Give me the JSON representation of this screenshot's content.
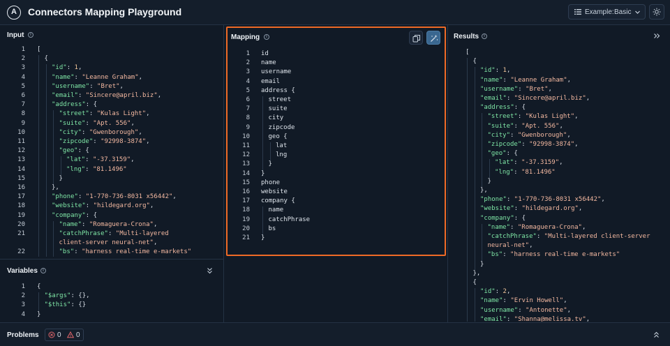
{
  "app": {
    "title": "Connectors Mapping Playground",
    "logo_letter": "A"
  },
  "header": {
    "example_label": "Example:",
    "example_value": "Basic"
  },
  "panels": {
    "input": "Input",
    "variables": "Variables",
    "mapping": "Mapping",
    "results": "Results",
    "problems": "Problems"
  },
  "problems": {
    "errors": "0",
    "warnings": "0"
  },
  "input_lines": [
    {
      "n": "1",
      "i": 0,
      "t": [
        [
          "punc",
          "["
        ]
      ]
    },
    {
      "n": "2",
      "i": 1,
      "t": [
        [
          "punc",
          "{"
        ]
      ]
    },
    {
      "n": "3",
      "i": 2,
      "t": [
        [
          "key",
          "\"id\""
        ],
        [
          "punc",
          ": "
        ],
        [
          "num",
          "1"
        ],
        [
          "punc",
          ","
        ]
      ]
    },
    {
      "n": "4",
      "i": 2,
      "t": [
        [
          "key",
          "\"name\""
        ],
        [
          "punc",
          ": "
        ],
        [
          "str",
          "\"Leanne Graham\""
        ],
        [
          "punc",
          ","
        ]
      ]
    },
    {
      "n": "5",
      "i": 2,
      "t": [
        [
          "key",
          "\"username\""
        ],
        [
          "punc",
          ": "
        ],
        [
          "str",
          "\"Bret\""
        ],
        [
          "punc",
          ","
        ]
      ]
    },
    {
      "n": "6",
      "i": 2,
      "t": [
        [
          "key",
          "\"email\""
        ],
        [
          "punc",
          ": "
        ],
        [
          "str",
          "\"Sincere@april.biz\""
        ],
        [
          "punc",
          ","
        ]
      ]
    },
    {
      "n": "7",
      "i": 2,
      "t": [
        [
          "key",
          "\"address\""
        ],
        [
          "punc",
          ": {"
        ]
      ]
    },
    {
      "n": "8",
      "i": 3,
      "t": [
        [
          "key",
          "\"street\""
        ],
        [
          "punc",
          ": "
        ],
        [
          "str",
          "\"Kulas Light\""
        ],
        [
          "punc",
          ","
        ]
      ]
    },
    {
      "n": "9",
      "i": 3,
      "t": [
        [
          "key",
          "\"suite\""
        ],
        [
          "punc",
          ": "
        ],
        [
          "str",
          "\"Apt. 556\""
        ],
        [
          "punc",
          ","
        ]
      ]
    },
    {
      "n": "10",
      "i": 3,
      "t": [
        [
          "key",
          "\"city\""
        ],
        [
          "punc",
          ": "
        ],
        [
          "str",
          "\"Gwenborough\""
        ],
        [
          "punc",
          ","
        ]
      ]
    },
    {
      "n": "11",
      "i": 3,
      "t": [
        [
          "key",
          "\"zipcode\""
        ],
        [
          "punc",
          ": "
        ],
        [
          "str",
          "\"92998-3874\""
        ],
        [
          "punc",
          ","
        ]
      ]
    },
    {
      "n": "12",
      "i": 3,
      "t": [
        [
          "key",
          "\"geo\""
        ],
        [
          "punc",
          ": {"
        ]
      ]
    },
    {
      "n": "13",
      "i": 4,
      "t": [
        [
          "key",
          "\"lat\""
        ],
        [
          "punc",
          ": "
        ],
        [
          "str",
          "\"-37.3159\""
        ],
        [
          "punc",
          ","
        ]
      ]
    },
    {
      "n": "14",
      "i": 4,
      "t": [
        [
          "key",
          "\"lng\""
        ],
        [
          "punc",
          ": "
        ],
        [
          "str",
          "\"81.1496\""
        ]
      ]
    },
    {
      "n": "15",
      "i": 3,
      "t": [
        [
          "punc",
          "}"
        ]
      ]
    },
    {
      "n": "16",
      "i": 2,
      "t": [
        [
          "punc",
          "},"
        ]
      ]
    },
    {
      "n": "17",
      "i": 2,
      "t": [
        [
          "key",
          "\"phone\""
        ],
        [
          "punc",
          ": "
        ],
        [
          "str",
          "\"1-770-736-8031 x56442\""
        ],
        [
          "punc",
          ","
        ]
      ]
    },
    {
      "n": "18",
      "i": 2,
      "t": [
        [
          "key",
          "\"website\""
        ],
        [
          "punc",
          ": "
        ],
        [
          "str",
          "\"hildegard.org\""
        ],
        [
          "punc",
          ","
        ]
      ]
    },
    {
      "n": "19",
      "i": 2,
      "t": [
        [
          "key",
          "\"company\""
        ],
        [
          "punc",
          ": {"
        ]
      ]
    },
    {
      "n": "20",
      "i": 3,
      "t": [
        [
          "key",
          "\"name\""
        ],
        [
          "punc",
          ": "
        ],
        [
          "str",
          "\"Romaguera-Crona\""
        ],
        [
          "punc",
          ","
        ]
      ]
    },
    {
      "n": "21",
      "i": 3,
      "t": [
        [
          "key",
          "\"catchPhrase\""
        ],
        [
          "punc",
          ": "
        ],
        [
          "str",
          "\"Multi-layered"
        ]
      ]
    },
    {
      "n": "",
      "i": 3,
      "t": [
        [
          "str",
          "client-server neural-net\""
        ],
        [
          "punc",
          ","
        ]
      ]
    },
    {
      "n": "22",
      "i": 3,
      "t": [
        [
          "key",
          "\"bs\""
        ],
        [
          "punc",
          ": "
        ],
        [
          "str",
          "\"harness real-time e-markets\""
        ]
      ]
    }
  ],
  "variables_lines": [
    {
      "n": "1",
      "i": 0,
      "t": [
        [
          "punc",
          "{"
        ]
      ]
    },
    {
      "n": "2",
      "i": 1,
      "t": [
        [
          "key",
          "\"$args\""
        ],
        [
          "punc",
          ": {},"
        ]
      ]
    },
    {
      "n": "3",
      "i": 1,
      "t": [
        [
          "key",
          "\"$this\""
        ],
        [
          "punc",
          ": {}"
        ]
      ]
    },
    {
      "n": "4",
      "i": 0,
      "t": [
        [
          "punc",
          "}"
        ]
      ]
    }
  ],
  "mapping_lines": [
    {
      "n": "1",
      "i": 0,
      "t": [
        [
          "ident",
          "id"
        ]
      ]
    },
    {
      "n": "2",
      "i": 0,
      "t": [
        [
          "ident",
          "name"
        ]
      ]
    },
    {
      "n": "3",
      "i": 0,
      "t": [
        [
          "ident",
          "username"
        ]
      ]
    },
    {
      "n": "4",
      "i": 0,
      "t": [
        [
          "ident",
          "email"
        ]
      ]
    },
    {
      "n": "5",
      "i": 0,
      "t": [
        [
          "ident",
          "address {"
        ]
      ]
    },
    {
      "n": "6",
      "i": 1,
      "t": [
        [
          "ident",
          "street"
        ]
      ]
    },
    {
      "n": "7",
      "i": 1,
      "t": [
        [
          "ident",
          "suite"
        ]
      ]
    },
    {
      "n": "8",
      "i": 1,
      "t": [
        [
          "ident",
          "city"
        ]
      ]
    },
    {
      "n": "9",
      "i": 1,
      "t": [
        [
          "ident",
          "zipcode"
        ]
      ]
    },
    {
      "n": "10",
      "i": 1,
      "t": [
        [
          "ident",
          "geo {"
        ]
      ]
    },
    {
      "n": "11",
      "i": 2,
      "t": [
        [
          "ident",
          "lat"
        ]
      ]
    },
    {
      "n": "12",
      "i": 2,
      "t": [
        [
          "ident",
          "lng"
        ]
      ]
    },
    {
      "n": "13",
      "i": 1,
      "t": [
        [
          "ident",
          "}"
        ]
      ]
    },
    {
      "n": "14",
      "i": 0,
      "t": [
        [
          "ident",
          "}"
        ]
      ]
    },
    {
      "n": "15",
      "i": 0,
      "t": [
        [
          "ident",
          "phone"
        ]
      ]
    },
    {
      "n": "16",
      "i": 0,
      "t": [
        [
          "ident",
          "website"
        ]
      ]
    },
    {
      "n": "17",
      "i": 0,
      "t": [
        [
          "ident",
          "company {"
        ]
      ]
    },
    {
      "n": "18",
      "i": 1,
      "t": [
        [
          "ident",
          "name"
        ]
      ]
    },
    {
      "n": "19",
      "i": 1,
      "t": [
        [
          "ident",
          "catchPhrase"
        ]
      ]
    },
    {
      "n": "20",
      "i": 1,
      "t": [
        [
          "ident",
          "bs"
        ]
      ]
    },
    {
      "n": "21",
      "i": 0,
      "t": [
        [
          "ident",
          "}"
        ]
      ]
    }
  ],
  "results_lines": [
    {
      "i": 0,
      "t": [
        [
          "punc",
          "["
        ]
      ]
    },
    {
      "i": 1,
      "t": [
        [
          "punc",
          "{"
        ]
      ]
    },
    {
      "i": 2,
      "t": [
        [
          "key",
          "\"id\""
        ],
        [
          "punc",
          ": "
        ],
        [
          "num",
          "1"
        ],
        [
          "punc",
          ","
        ]
      ]
    },
    {
      "i": 2,
      "t": [
        [
          "key",
          "\"name\""
        ],
        [
          "punc",
          ": "
        ],
        [
          "str",
          "\"Leanne Graham\""
        ],
        [
          "punc",
          ","
        ]
      ]
    },
    {
      "i": 2,
      "t": [
        [
          "key",
          "\"username\""
        ],
        [
          "punc",
          ": "
        ],
        [
          "str",
          "\"Bret\""
        ],
        [
          "punc",
          ","
        ]
      ]
    },
    {
      "i": 2,
      "t": [
        [
          "key",
          "\"email\""
        ],
        [
          "punc",
          ": "
        ],
        [
          "str",
          "\"Sincere@april.biz\""
        ],
        [
          "punc",
          ","
        ]
      ]
    },
    {
      "i": 2,
      "t": [
        [
          "key",
          "\"address\""
        ],
        [
          "punc",
          ": {"
        ]
      ]
    },
    {
      "i": 3,
      "t": [
        [
          "key",
          "\"street\""
        ],
        [
          "punc",
          ": "
        ],
        [
          "str",
          "\"Kulas Light\""
        ],
        [
          "punc",
          ","
        ]
      ]
    },
    {
      "i": 3,
      "t": [
        [
          "key",
          "\"suite\""
        ],
        [
          "punc",
          ": "
        ],
        [
          "str",
          "\"Apt. 556\""
        ],
        [
          "punc",
          ","
        ]
      ]
    },
    {
      "i": 3,
      "t": [
        [
          "key",
          "\"city\""
        ],
        [
          "punc",
          ": "
        ],
        [
          "str",
          "\"Gwenborough\""
        ],
        [
          "punc",
          ","
        ]
      ]
    },
    {
      "i": 3,
      "t": [
        [
          "key",
          "\"zipcode\""
        ],
        [
          "punc",
          ": "
        ],
        [
          "str",
          "\"92998-3874\""
        ],
        [
          "punc",
          ","
        ]
      ]
    },
    {
      "i": 3,
      "t": [
        [
          "key",
          "\"geo\""
        ],
        [
          "punc",
          ": {"
        ]
      ]
    },
    {
      "i": 4,
      "t": [
        [
          "key",
          "\"lat\""
        ],
        [
          "punc",
          ": "
        ],
        [
          "str",
          "\"-37.3159\""
        ],
        [
          "punc",
          ","
        ]
      ]
    },
    {
      "i": 4,
      "t": [
        [
          "key",
          "\"lng\""
        ],
        [
          "punc",
          ": "
        ],
        [
          "str",
          "\"81.1496\""
        ]
      ]
    },
    {
      "i": 3,
      "t": [
        [
          "punc",
          "}"
        ]
      ]
    },
    {
      "i": 2,
      "t": [
        [
          "punc",
          "},"
        ]
      ]
    },
    {
      "i": 2,
      "t": [
        [
          "key",
          "\"phone\""
        ],
        [
          "punc",
          ": "
        ],
        [
          "str",
          "\"1-770-736-8031 x56442\""
        ],
        [
          "punc",
          ","
        ]
      ]
    },
    {
      "i": 2,
      "t": [
        [
          "key",
          "\"website\""
        ],
        [
          "punc",
          ": "
        ],
        [
          "str",
          "\"hildegard.org\""
        ],
        [
          "punc",
          ","
        ]
      ]
    },
    {
      "i": 2,
      "t": [
        [
          "key",
          "\"company\""
        ],
        [
          "punc",
          ": {"
        ]
      ]
    },
    {
      "i": 3,
      "t": [
        [
          "key",
          "\"name\""
        ],
        [
          "punc",
          ": "
        ],
        [
          "str",
          "\"Romaguera-Crona\""
        ],
        [
          "punc",
          ","
        ]
      ]
    },
    {
      "i": 3,
      "t": [
        [
          "key",
          "\"catchPhrase\""
        ],
        [
          "punc",
          ": "
        ],
        [
          "str",
          "\"Multi-layered client-server"
        ]
      ]
    },
    {
      "i": 3,
      "t": [
        [
          "str",
          "neural-net\""
        ],
        [
          "punc",
          ","
        ]
      ]
    },
    {
      "i": 3,
      "t": [
        [
          "key",
          "\"bs\""
        ],
        [
          "punc",
          ": "
        ],
        [
          "str",
          "\"harness real-time e-markets\""
        ]
      ]
    },
    {
      "i": 2,
      "t": [
        [
          "punc",
          "}"
        ]
      ]
    },
    {
      "i": 1,
      "t": [
        [
          "punc",
          "},"
        ]
      ]
    },
    {
      "i": 1,
      "t": [
        [
          "punc",
          "{"
        ]
      ]
    },
    {
      "i": 2,
      "t": [
        [
          "key",
          "\"id\""
        ],
        [
          "punc",
          ": "
        ],
        [
          "num",
          "2"
        ],
        [
          "punc",
          ","
        ]
      ]
    },
    {
      "i": 2,
      "t": [
        [
          "key",
          "\"name\""
        ],
        [
          "punc",
          ": "
        ],
        [
          "str",
          "\"Ervin Howell\""
        ],
        [
          "punc",
          ","
        ]
      ]
    },
    {
      "i": 2,
      "t": [
        [
          "key",
          "\"username\""
        ],
        [
          "punc",
          ": "
        ],
        [
          "str",
          "\"Antonette\""
        ],
        [
          "punc",
          ","
        ]
      ]
    },
    {
      "i": 2,
      "t": [
        [
          "key",
          "\"email\""
        ],
        [
          "punc",
          ": "
        ],
        [
          "str",
          "\"Shanna@melissa.tv\""
        ],
        [
          "punc",
          ","
        ]
      ]
    }
  ]
}
